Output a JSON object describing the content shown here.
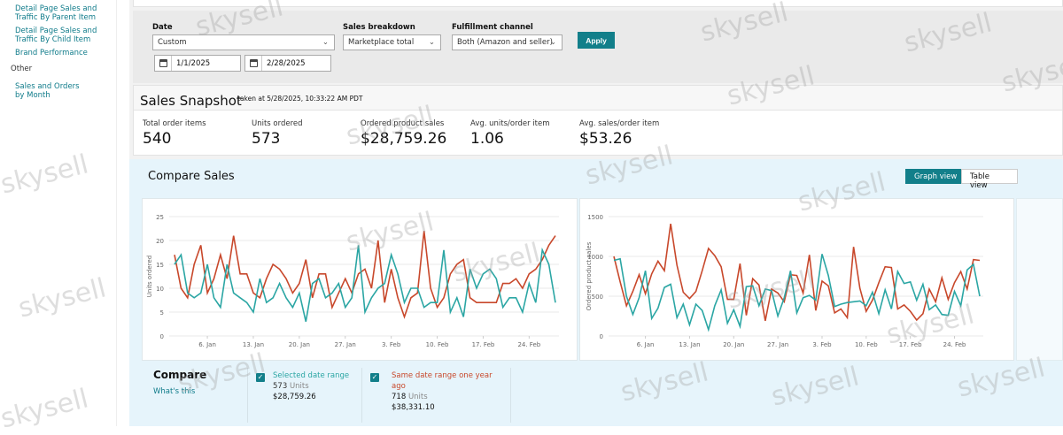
{
  "sidebar": {
    "items": [
      {
        "label": "Detail Page Sales and Traffic By Parent Item"
      },
      {
        "label": "Detail Page Sales and Traffic By Child Item"
      },
      {
        "label": "Brand Performance"
      }
    ],
    "group": "Other",
    "items2": [
      {
        "label": "Sales and Orders by Month"
      }
    ]
  },
  "filters": {
    "date_label": "Date",
    "date_value": "Custom",
    "start_date": "1/1/2025",
    "end_date": "2/28/2025",
    "breakdown_label": "Sales breakdown",
    "breakdown_value": "Marketplace total",
    "channel_label": "Fulfillment channel",
    "channel_value": "Both (Amazon and seller)",
    "apply": "Apply"
  },
  "snapshot": {
    "title": "Sales Snapshot",
    "taken": "taken at 5/28/2025, 10:33:22 AM PDT",
    "metrics": [
      {
        "label": "Total order items",
        "value": "540"
      },
      {
        "label": "Units ordered",
        "value": "573"
      },
      {
        "label": "Ordered product sales",
        "value": "$28,759.26"
      },
      {
        "label": "Avg. units/order item",
        "value": "1.06"
      },
      {
        "label": "Avg. sales/order item",
        "value": "$53.26"
      }
    ]
  },
  "compare": {
    "title": "Compare Sales",
    "graph_view": "Graph view",
    "table_view": "Table view",
    "footer_title": "Compare",
    "whats_this": "What's this",
    "selected": {
      "label": "Selected date range",
      "units": "573",
      "units_suffix": "Units",
      "sales": "$28,759.26"
    },
    "last_year": {
      "label": "Same date range one year ago",
      "units": "718",
      "units_suffix": "Units",
      "sales": "$38,331.10"
    }
  },
  "colors": {
    "current": "#2ba6a4",
    "last_year": "#c8482b",
    "accent": "#127f8a"
  },
  "watermark": "skysell",
  "chart_data": [
    {
      "type": "line",
      "ylabel": "Units ordered",
      "ylim": [
        0,
        25
      ],
      "yticks": [
        0,
        5,
        10,
        15,
        20,
        25
      ],
      "xticks": [
        "6. Jan",
        "13. Jan",
        "20. Jan",
        "27. Jan",
        "3. Feb",
        "10. Feb",
        "17. Feb",
        "24. Feb"
      ],
      "x_start": "2025-01-01",
      "x_end": "2025-02-28",
      "grid": true,
      "series": [
        {
          "values": [
            15,
            17,
            9,
            8,
            9,
            15,
            8,
            6,
            15,
            9,
            8,
            7,
            5,
            12,
            7,
            8,
            11,
            8,
            6,
            9,
            3,
            11,
            12,
            8,
            9,
            11,
            6,
            8,
            19,
            5,
            8,
            10,
            11,
            17,
            13,
            7,
            10,
            10,
            6,
            7,
            7,
            18,
            5,
            8,
            4,
            14,
            10,
            13,
            14,
            12,
            6,
            8,
            8,
            5,
            11,
            7,
            18,
            15,
            7
          ]
        },
        {
          "values": [
            17,
            10,
            8,
            15,
            19,
            9,
            12,
            17,
            12,
            21,
            13,
            13,
            9,
            8,
            12,
            15,
            14,
            12,
            9,
            11,
            16,
            8,
            13,
            13,
            6,
            9,
            12,
            9,
            13,
            14,
            10,
            20,
            7,
            14,
            8,
            4,
            8,
            9,
            22,
            10,
            6,
            8,
            13,
            15,
            16,
            8,
            7,
            7,
            7,
            7,
            11,
            11,
            12,
            10,
            13,
            14,
            16,
            19,
            21
          ]
        }
      ]
    },
    {
      "type": "line",
      "ylabel": "Ordered product sales",
      "ylim": [
        0,
        1500
      ],
      "yticks": [
        0,
        500,
        1000,
        1500
      ],
      "xticks": [
        "6. Jan",
        "13. Jan",
        "20. Jan",
        "27. Jan",
        "3. Feb",
        "10. Feb",
        "17. Feb",
        "24. Feb"
      ],
      "x_start": "2025-01-01",
      "x_end": "2025-02-28",
      "grid": true,
      "series": [
        {
          "values": [
            950,
            970,
            500,
            270,
            480,
            820,
            220,
            350,
            610,
            650,
            230,
            400,
            140,
            400,
            320,
            80,
            380,
            580,
            160,
            330,
            120,
            620,
            630,
            380,
            590,
            570,
            250,
            480,
            820,
            290,
            480,
            510,
            450,
            1030,
            760,
            370,
            400,
            420,
            430,
            440,
            380,
            550,
            280,
            580,
            340,
            810,
            660,
            680,
            450,
            650,
            330,
            390,
            270,
            260,
            560,
            380,
            830,
            900,
            500
          ]
        },
        {
          "values": [
            1000,
            680,
            380,
            560,
            770,
            530,
            780,
            940,
            820,
            1410,
            890,
            550,
            470,
            560,
            820,
            1100,
            1010,
            870,
            460,
            460,
            910,
            260,
            720,
            640,
            190,
            590,
            540,
            430,
            770,
            760,
            540,
            1020,
            320,
            690,
            630,
            290,
            340,
            230,
            1120,
            600,
            310,
            450,
            670,
            870,
            860,
            340,
            390,
            310,
            200,
            280,
            590,
            430,
            730,
            460,
            670,
            810,
            590,
            960,
            950
          ]
        }
      ]
    }
  ]
}
